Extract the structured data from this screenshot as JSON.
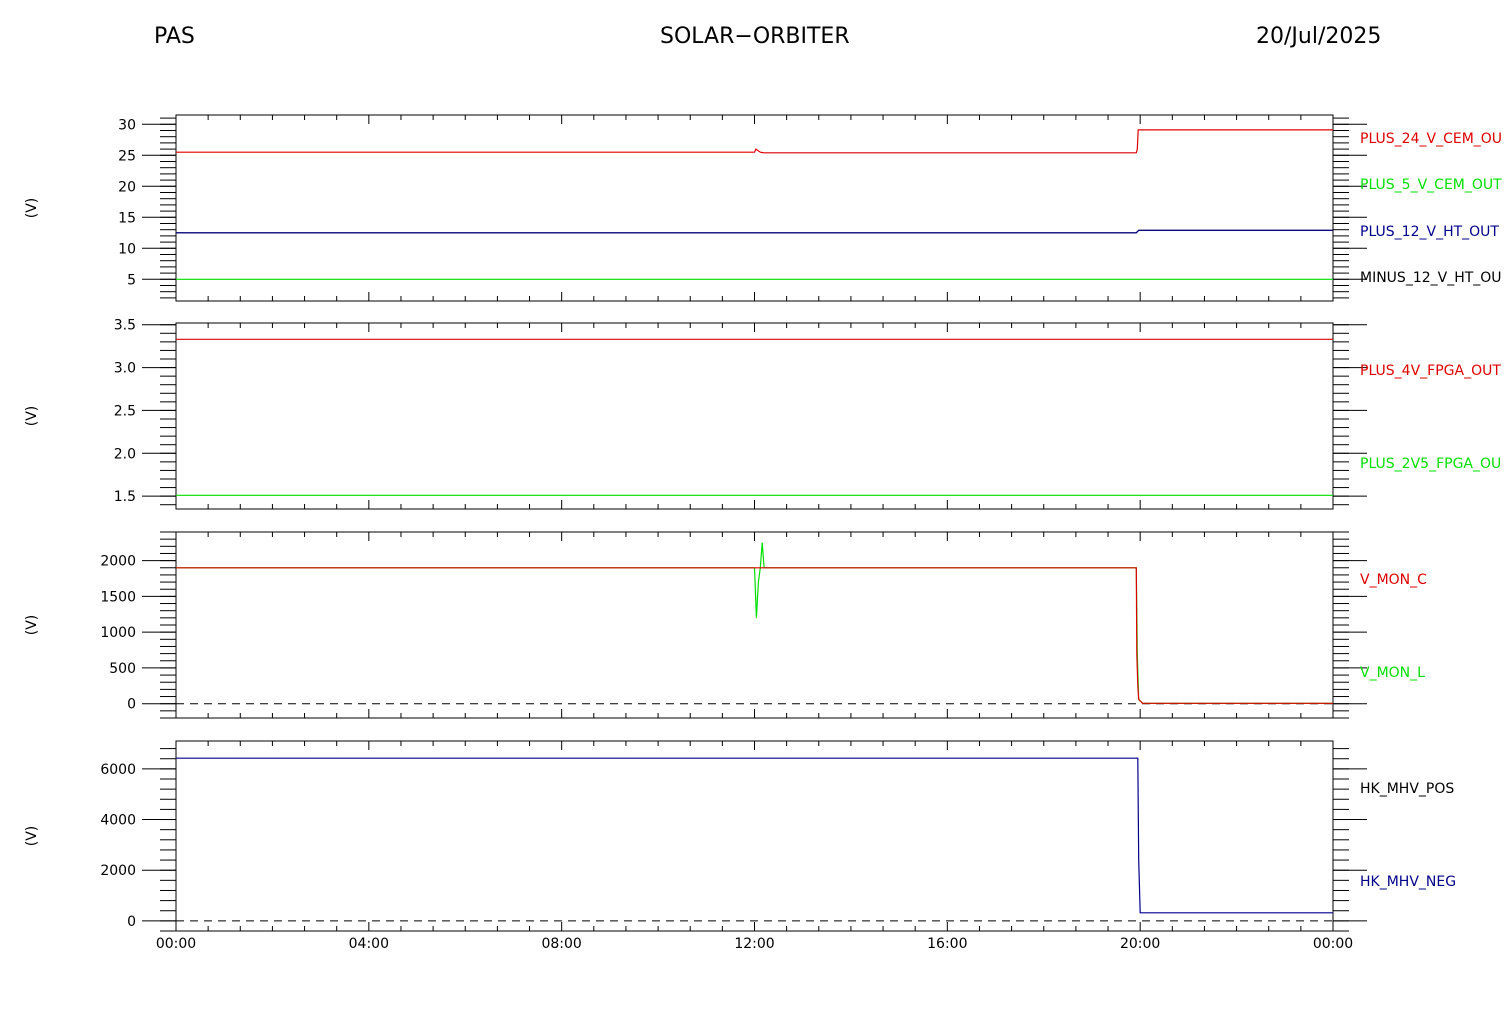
{
  "header": {
    "left": "PAS",
    "center": "SOLAR−ORBITER",
    "right": "20/Jul/2025"
  },
  "x_axis": {
    "tick_labels": [
      "00:00",
      "04:00",
      "08:00",
      "12:00",
      "16:00",
      "20:00",
      "00:00"
    ],
    "range_hours": [
      0,
      24
    ]
  },
  "chart_data": [
    {
      "type": "line",
      "ylabel": "(V)",
      "ylim": [
        1.5,
        31.5
      ],
      "y_ticks": [
        5,
        10,
        15,
        20,
        25,
        30
      ],
      "grid": false,
      "legend_position": "right",
      "series": [
        {
          "name": "PLUS_24_V_CEM_OU",
          "color": "#e00000",
          "x": [
            0,
            12.0,
            12.03,
            12.12,
            12.2,
            19.92,
            19.94,
            19.96,
            24
          ],
          "y": [
            25.5,
            25.5,
            26.0,
            25.5,
            25.4,
            25.4,
            26.0,
            29.1,
            29.1
          ]
        },
        {
          "name": "PLUS_5_V_CEM_OUT",
          "color": "#00e000",
          "x": [
            0,
            24
          ],
          "y": [
            5.0,
            5.0
          ]
        },
        {
          "name": "PLUS_12_V_HT_OUT",
          "color": "#00008b",
          "x": [
            0,
            19.92,
            19.97,
            24
          ],
          "y": [
            12.5,
            12.5,
            12.9,
            12.9
          ]
        },
        {
          "name": "MINUS_12_V_HT_OU",
          "color": "#000000",
          "x": [
            0,
            19.92,
            19.97,
            24
          ],
          "y": [
            12.5,
            12.5,
            12.9,
            12.9
          ]
        }
      ]
    },
    {
      "type": "line",
      "ylabel": "(V)",
      "ylim": [
        1.35,
        3.52
      ],
      "y_ticks": [
        1.5,
        2.0,
        2.5,
        3.0,
        3.5
      ],
      "y_tick_labels": [
        "1.5",
        "2.0",
        "2.5",
        "3.0",
        "3.5"
      ],
      "grid": false,
      "legend_position": "right",
      "series": [
        {
          "name": "PLUS_4V_FPGA_OUT",
          "color": "#e00000",
          "x": [
            0,
            24
          ],
          "y": [
            3.33,
            3.33
          ]
        },
        {
          "name": "PLUS_2V5_FPGA_OU",
          "color": "#00e000",
          "x": [
            0,
            24
          ],
          "y": [
            1.51,
            1.51
          ]
        }
      ]
    },
    {
      "type": "line",
      "ylabel": "(V)",
      "ylim": [
        -200,
        2400
      ],
      "y_ticks": [
        0,
        500,
        1000,
        1500,
        2000
      ],
      "zero_line": true,
      "grid": false,
      "legend_position": "right",
      "series": [
        {
          "name": "V_MON_C",
          "color": "#e00000",
          "x": [
            0,
            19.92,
            19.93,
            19.95,
            19.97,
            20.05,
            24
          ],
          "y": [
            1900,
            1900,
            700,
            250,
            60,
            5,
            5
          ]
        },
        {
          "name": "V_MON_L",
          "color": "#00e000",
          "x": [
            0,
            12.0,
            12.04,
            12.08,
            12.12,
            12.16,
            12.2,
            12.24,
            19.92,
            19.94,
            19.97,
            20.05,
            24
          ],
          "y": [
            1900,
            1900,
            1200,
            1700,
            1900,
            2250,
            1900,
            1900,
            1900,
            700,
            60,
            5,
            5
          ]
        }
      ]
    },
    {
      "type": "line",
      "ylabel": "(V)",
      "ylim": [
        -400,
        7100
      ],
      "y_ticks": [
        0,
        2000,
        4000,
        6000
      ],
      "zero_line": true,
      "grid": false,
      "legend_position": "right",
      "series": [
        {
          "name": "HK_MHV_POS",
          "color": "#000000",
          "x": [],
          "y": []
        },
        {
          "name": "HK_MHV_NEG",
          "color": "#00008b",
          "x": [
            0,
            19.95,
            19.97,
            20.0,
            24
          ],
          "y": [
            6420,
            6420,
            2400,
            320,
            320
          ]
        }
      ]
    }
  ]
}
